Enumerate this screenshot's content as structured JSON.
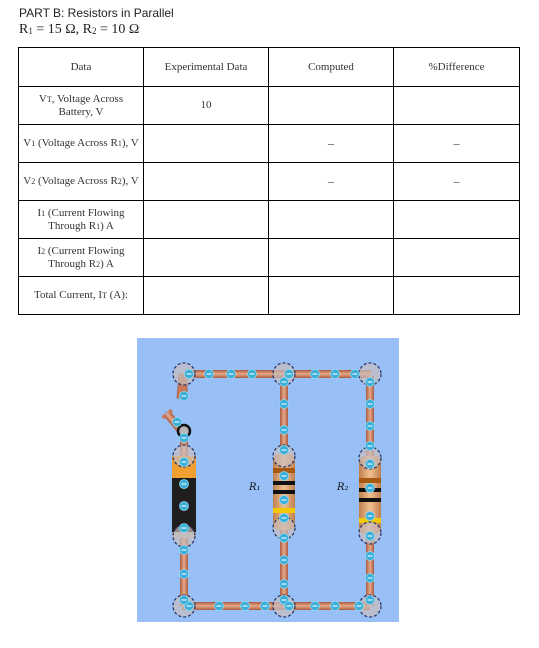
{
  "heading": "PART B: Resistors in Parallel",
  "given": {
    "r1_label": "R",
    "r1_sub": "1",
    "r1_value": "= 15 Ω,",
    "r2_label": "R",
    "r2_sub": "2",
    "r2_value": "= 10 Ω"
  },
  "table": {
    "headers": [
      "Data",
      "Experimental Data",
      "Computed",
      "%Difference"
    ],
    "rows": [
      {
        "label_a": "V",
        "label_sub": "T",
        "label_b": ", Voltage Across Battery, V",
        "experimental": "10",
        "computed": "",
        "difference": ""
      },
      {
        "label_a": "V",
        "label_sub": "1",
        "label_b": " (Voltage Across R",
        "label_sub2": "1",
        "label_c": "), V",
        "experimental": "",
        "computed": "–",
        "difference": "–"
      },
      {
        "label_a": "V",
        "label_sub": "2",
        "label_b": " (Voltage Across R",
        "label_sub2": "2",
        "label_c": "), V",
        "experimental": "",
        "computed": "–",
        "difference": "–"
      },
      {
        "label_a": "I",
        "label_sub": "1",
        "label_b": " (Current Flowing Through R",
        "label_sub2": "1",
        "label_c": ") A",
        "experimental": "",
        "computed": "",
        "difference": ""
      },
      {
        "label_a": "I",
        "label_sub": "2",
        "label_b": " (Current Flowing Through R",
        "label_sub2": "2",
        "label_c": ") A",
        "experimental": "",
        "computed": "",
        "difference": ""
      },
      {
        "label_a": "Total Current, I",
        "label_sub": "T",
        "label_b": " (A):",
        "experimental": "",
        "computed": "",
        "difference": ""
      }
    ]
  },
  "circuit": {
    "r1_label": "R₁",
    "r2_label": "R₂",
    "colors": {
      "background": "#99bff7",
      "wire": "#c8795a",
      "electron": "#3aaed8",
      "battery_body": "#1e1e1e",
      "battery_cap": "#f0a030"
    }
  }
}
